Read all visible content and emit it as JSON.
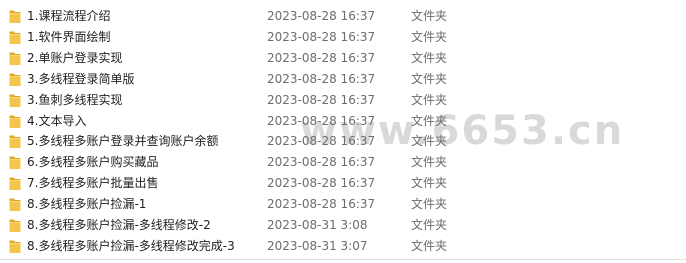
{
  "folder_type_label": "文件夹",
  "files": [
    {
      "name": "1.课程流程介绍",
      "modified": "2023-08-28 16:37",
      "type": "文件夹"
    },
    {
      "name": "1.软件界面绘制",
      "modified": "2023-08-28 16:37",
      "type": "文件夹"
    },
    {
      "name": "2.单账户登录实现",
      "modified": "2023-08-28 16:37",
      "type": "文件夹"
    },
    {
      "name": "3.多线程登录简单版",
      "modified": "2023-08-28 16:37",
      "type": "文件夹"
    },
    {
      "name": "3.鱼刺多线程实现",
      "modified": "2023-08-28 16:37",
      "type": "文件夹"
    },
    {
      "name": "4.文本导入",
      "modified": "2023-08-28 16:37",
      "type": "文件夹"
    },
    {
      "name": "5.多线程多账户登录并查询账户余额",
      "modified": "2023-08-28 16:37",
      "type": "文件夹"
    },
    {
      "name": "6.多线程多账户购买藏品",
      "modified": "2023-08-28 16:37",
      "type": "文件夹"
    },
    {
      "name": "7.多线程多账户批量出售",
      "modified": "2023-08-28 16:37",
      "type": "文件夹"
    },
    {
      "name": "8.多线程多账户捡漏-1",
      "modified": "2023-08-28 16:37",
      "type": "文件夹"
    },
    {
      "name": "8.多线程多账户捡漏-多线程修改-2",
      "modified": "2023-08-31 3:08",
      "type": "文件夹"
    },
    {
      "name": "8.多线程多账户捡漏-多线程修改完成-3",
      "modified": "2023-08-31 3:07",
      "type": "文件夹"
    }
  ],
  "watermark": "www.6653.cn",
  "colors": {
    "folder_body": "#f3c54d",
    "folder_tab": "#e0a828",
    "text": "#1f1f1f",
    "meta_text": "#6d6d6d"
  }
}
